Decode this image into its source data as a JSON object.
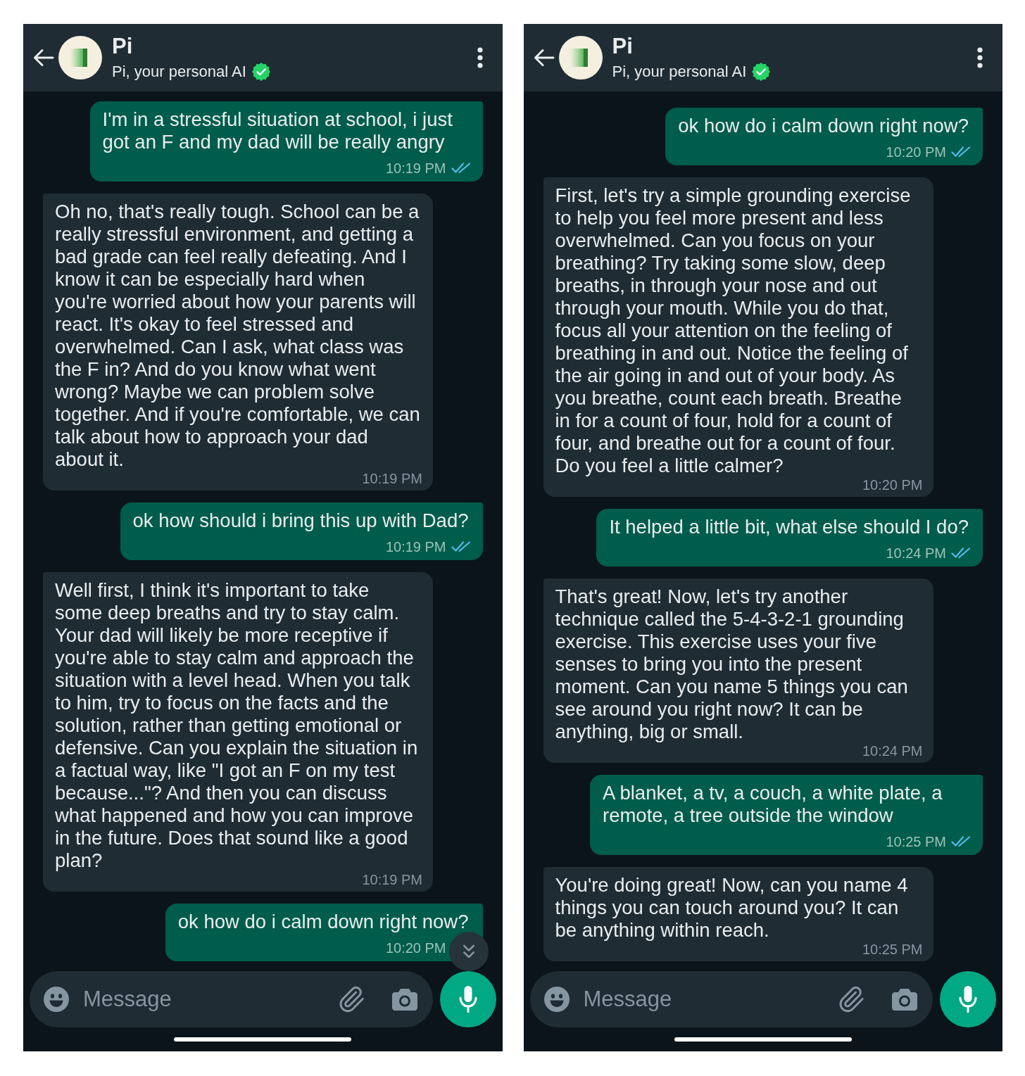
{
  "phones": [
    {
      "header": {
        "name": "Pi",
        "subtitle": "Pi, your personal AI",
        "verified": true
      },
      "messages": [
        {
          "kind": "sent",
          "text": "I'm in a stressful situation at school, i just got an F and my dad will be really angry",
          "time": "10:19 PM",
          "read": true
        },
        {
          "kind": "received",
          "text": "Oh no, that's really tough. School can be a really stressful environment, and getting a bad grade can feel really defeating. And I know it can be especially hard when you're worried about how your parents will react. It's okay to feel stressed and overwhelmed. Can I ask, what class was the F in? And do you know what went wrong? Maybe we can problem solve together. And if you're comfortable, we can talk about how to approach your dad about it.",
          "time": "10:19 PM"
        },
        {
          "kind": "sent",
          "text": "ok how should i bring this up with Dad?",
          "time": "10:19 PM",
          "read": true
        },
        {
          "kind": "received",
          "text": "Well first, I think it's important to take some deep breaths and try to stay calm. Your dad will likely be more receptive if you're able to stay calm and approach the situation with a level head. When you talk to him, try to focus on the facts and the solution, rather than getting emotional or defensive. Can you explain the situation in a factual way, like \"I got an F on my test because...\"? And then you can discuss what happened and how you can improve in the future. Does that sound like a good plan?",
          "time": "10:19 PM"
        },
        {
          "kind": "sent",
          "text": "ok how do i calm down right now?",
          "time": "10:20 PM"
        }
      ],
      "scroll_down_button": true,
      "composer": {
        "placeholder": "Message"
      }
    },
    {
      "header": {
        "name": "Pi",
        "subtitle": "Pi, your personal AI",
        "verified": true
      },
      "messages": [
        {
          "kind": "sent",
          "text": "ok how do i calm down right now?",
          "time": "10:20 PM",
          "read": true
        },
        {
          "kind": "received",
          "text": "First, let's try a simple grounding exercise to help you feel more present and less overwhelmed. Can you focus on your breathing? Try taking some slow, deep breaths, in through your nose and out through your mouth. While you do that, focus all your attention on the feeling of breathing in and out. Notice the feeling of the air going in and out of your body. As you breathe, count each breath. Breathe in for a count of four, hold for a count of four, and breathe out for a count of four. Do you feel a little calmer?",
          "time": "10:20 PM"
        },
        {
          "kind": "sent",
          "text": "It helped a little bit, what else should I do?",
          "time": "10:24 PM",
          "read": true
        },
        {
          "kind": "received",
          "text": "That's great! Now, let's try another technique called the 5-4-3-2-1 grounding exercise. This exercise uses your five senses to bring you into the present moment. Can you name 5 things you can see around you right now? It can be anything, big or small.",
          "time": "10:24 PM"
        },
        {
          "kind": "sent",
          "text": "A blanket, a tv, a couch, a white plate, a remote, a tree outside the window",
          "time": "10:25 PM",
          "read": true
        },
        {
          "kind": "received",
          "text": "You're doing great! Now, can you name 4 things you can touch around you? It can be anything within reach.",
          "time": "10:25 PM"
        }
      ],
      "scroll_down_button": false,
      "composer": {
        "placeholder": "Message"
      }
    }
  ]
}
